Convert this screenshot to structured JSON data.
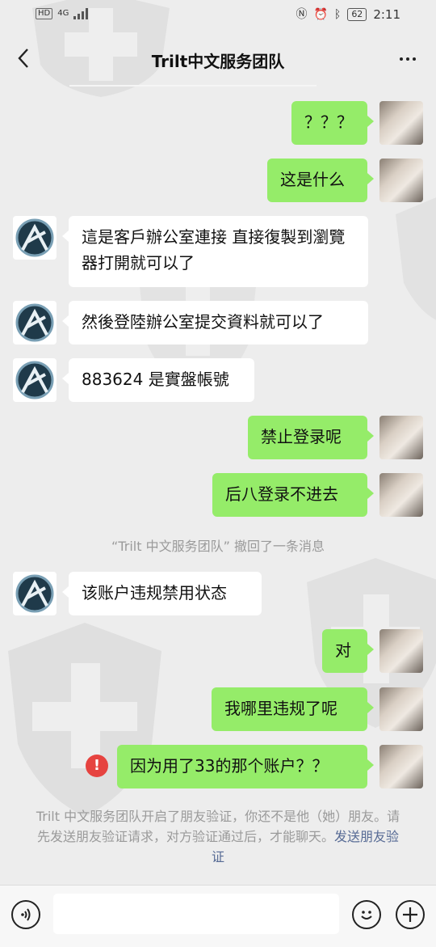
{
  "status_bar": {
    "hd": "HD",
    "network": "4G",
    "battery": "62",
    "time": "2:11"
  },
  "header": {
    "title": "Trilt中文服务团队"
  },
  "messages": [
    {
      "side": "right",
      "text": "？？？"
    },
    {
      "side": "right",
      "text": "这是什么"
    },
    {
      "side": "left",
      "text": "這是客戶辦公室連接 直接復製到瀏覽器打開就可以了"
    },
    {
      "side": "left",
      "text": "然後登陸辦公室提交資料就可以了"
    },
    {
      "side": "left",
      "text": "883624 是實盤帳號"
    },
    {
      "side": "right",
      "text": "禁止登录呢"
    },
    {
      "side": "right",
      "text": "后八登录不进去"
    },
    {
      "side": "left",
      "text": "该账户违规禁用状态"
    },
    {
      "side": "right",
      "text": "对"
    },
    {
      "side": "right",
      "text": "我哪里违规了呢"
    },
    {
      "side": "right",
      "text": "因为用了33的那个账户？？",
      "failed": true
    }
  ],
  "system_message": "“Trilt 中文服务团队” 撤回了一条消息",
  "friend_notice": {
    "text": "Trilt 中文服务团队开启了朋友验证，你还不是他（她）朋友。请先发送朋友验证请求，对方验证通过后，才能聊天。",
    "link": "发送朋友验证"
  },
  "error_icon": "!",
  "icons": {
    "back": "chevron-left-icon",
    "more": "more-dots-icon",
    "voice": "voice-icon",
    "emoji": "emoji-icon",
    "plus": "plus-icon",
    "error": "error-icon"
  }
}
